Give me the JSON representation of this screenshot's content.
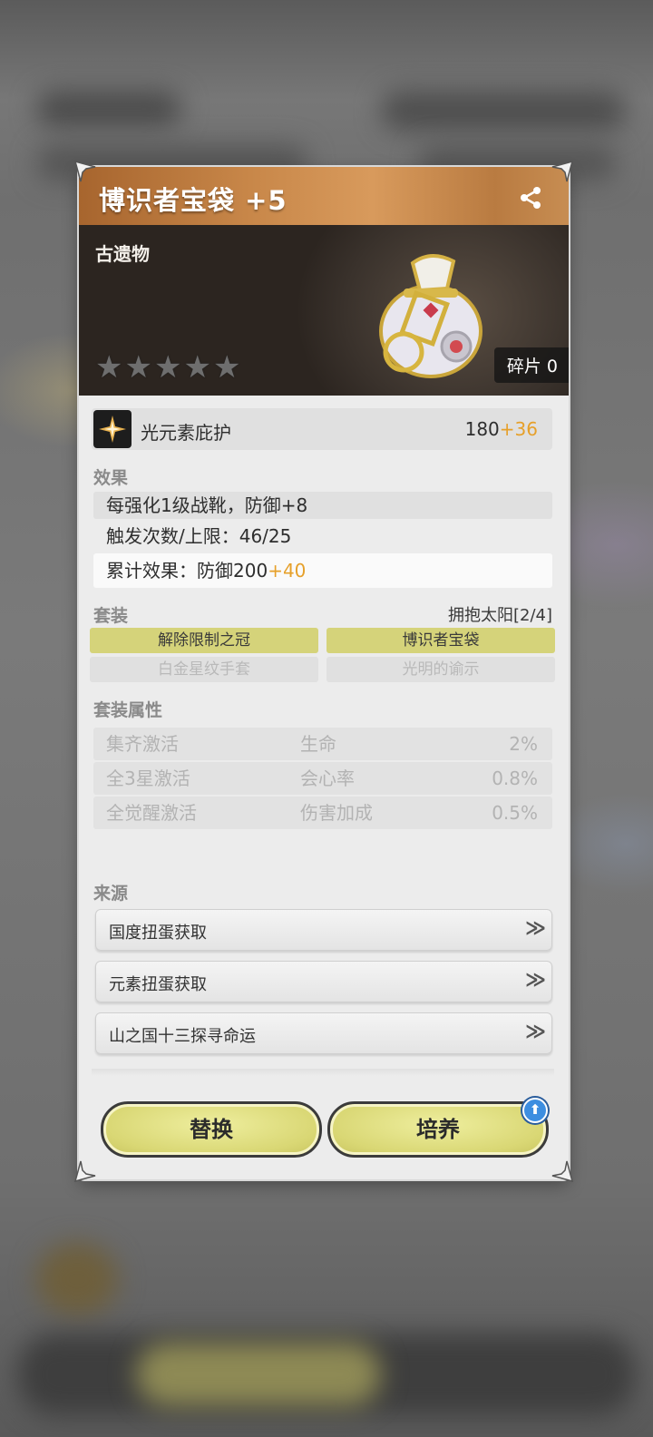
{
  "item": {
    "title": "博识者宝袋 +5",
    "type": "古遗物",
    "stars": "★★★★★",
    "fragment": "碎片 0"
  },
  "stat": {
    "name": "光元素庇护",
    "base": "180",
    "bonus": "+36"
  },
  "effect": {
    "label": "效果",
    "line1": "每强化1级战靴，防御+8",
    "line2": "触发次数/上限：46/25",
    "line3_prefix": "累计效果：防御200",
    "line3_bonus": "+40"
  },
  "set": {
    "label": "套装",
    "name": "拥抱太阳[2/4]",
    "pieces": [
      {
        "name": "解除限制之冠",
        "active": true
      },
      {
        "name": "博识者宝袋",
        "active": true
      },
      {
        "name": "白金星纹手套",
        "active": false
      },
      {
        "name": "光明的谕示",
        "active": false
      }
    ]
  },
  "set_attrs": {
    "label": "套装属性",
    "rows": [
      {
        "cond": "集齐激活",
        "stat": "生命",
        "value": "2%"
      },
      {
        "cond": "全3星激活",
        "stat": "会心率",
        "value": "0.8%"
      },
      {
        "cond": "全觉醒激活",
        "stat": "伤害加成",
        "value": "0.5%"
      }
    ]
  },
  "sources": {
    "label": "来源",
    "items": [
      "国度扭蛋获取",
      "元素扭蛋获取",
      "山之国十三探寻命运"
    ],
    "arrow": "≫"
  },
  "buttons": {
    "replace": "替换",
    "cultivate": "培养",
    "badge": "⬆"
  },
  "colors": {
    "accent_gold": "#e6a02a",
    "title_bar": "#c88749",
    "button_yellow": "#d9d774",
    "active_set": "#d5d37a"
  }
}
